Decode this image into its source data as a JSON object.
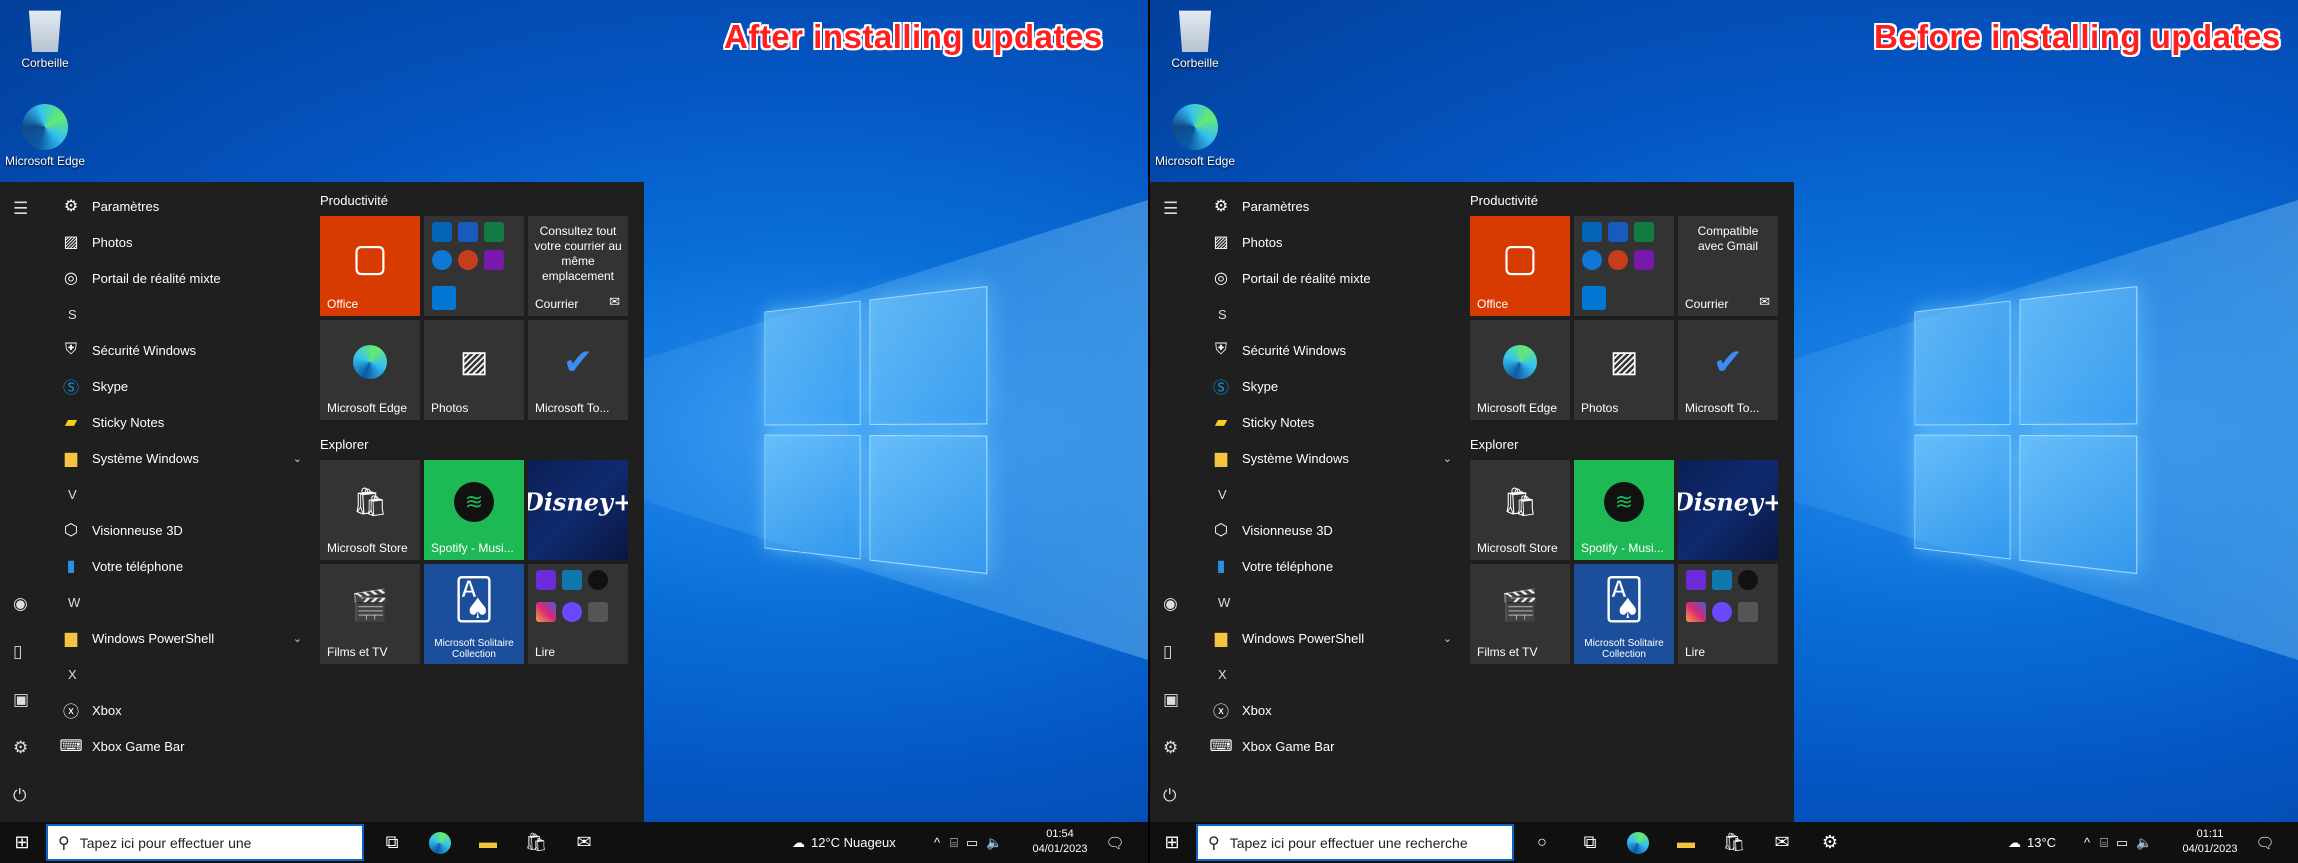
{
  "panels": [
    {
      "id": "left",
      "caption": "After installing updates",
      "desktop": {
        "recycle": "Corbeille",
        "edge": "Microsoft Edge"
      },
      "applist": [
        {
          "type": "app",
          "label": "Paramètres",
          "icon": "gear-icon"
        },
        {
          "type": "app",
          "label": "Photos",
          "icon": "photos-icon"
        },
        {
          "type": "app",
          "label": "Portail de réalité mixte",
          "icon": "mixed-reality-icon"
        },
        {
          "type": "letter",
          "label": "S"
        },
        {
          "type": "app",
          "label": "Sécurité Windows",
          "icon": "shield-icon"
        },
        {
          "type": "app",
          "label": "Skype",
          "icon": "skype-icon"
        },
        {
          "type": "app",
          "label": "Sticky Notes",
          "icon": "sticky-notes-icon"
        },
        {
          "type": "folder",
          "label": "Système Windows",
          "icon": "folder-icon"
        },
        {
          "type": "letter",
          "label": "V"
        },
        {
          "type": "app",
          "label": "Visionneuse 3D",
          "icon": "cube-icon"
        },
        {
          "type": "app",
          "label": "Votre téléphone",
          "icon": "phone-icon"
        },
        {
          "type": "letter",
          "label": "W"
        },
        {
          "type": "folder",
          "label": "Windows PowerShell",
          "icon": "folder-icon"
        },
        {
          "type": "letter",
          "label": "X"
        },
        {
          "type": "app",
          "label": "Xbox",
          "icon": "xbox-icon"
        },
        {
          "type": "app",
          "label": "Xbox Game Bar",
          "icon": "game-bar-icon"
        }
      ],
      "groups": {
        "g1": "Productivité",
        "g2": "Explorer"
      },
      "tiles": {
        "office": "Office",
        "mail_text": "Consultez tout votre courrier au même emplacement",
        "mail": "Courrier",
        "edge": "Microsoft Edge",
        "photos": "Photos",
        "todo": "Microsoft To...",
        "store": "Microsoft Store",
        "spotify": "Spotify - Musi...",
        "disney": "Disney+",
        "films": "Films et TV",
        "solitaire": "Microsoft Solitaire Collection",
        "lire": "Lire"
      },
      "taskbar": {
        "search_placeholder": "Tapez ici pour effectuer une",
        "weather": "12°C  Nuageux",
        "time": "01:54",
        "date": "04/01/2023"
      }
    },
    {
      "id": "right",
      "caption": "Before installing updates",
      "desktop": {
        "recycle": "Corbeille",
        "edge": "Microsoft Edge"
      },
      "applist": [
        {
          "type": "app",
          "label": "Paramètres",
          "icon": "gear-icon"
        },
        {
          "type": "app",
          "label": "Photos",
          "icon": "photos-icon"
        },
        {
          "type": "app",
          "label": "Portail de réalité mixte",
          "icon": "mixed-reality-icon"
        },
        {
          "type": "letter",
          "label": "S"
        },
        {
          "type": "app",
          "label": "Sécurité Windows",
          "icon": "shield-icon"
        },
        {
          "type": "app",
          "label": "Skype",
          "icon": "skype-icon"
        },
        {
          "type": "app",
          "label": "Sticky Notes",
          "icon": "sticky-notes-icon"
        },
        {
          "type": "folder",
          "label": "Système Windows",
          "icon": "folder-icon"
        },
        {
          "type": "letter",
          "label": "V"
        },
        {
          "type": "app",
          "label": "Visionneuse 3D",
          "icon": "cube-icon"
        },
        {
          "type": "app",
          "label": "Votre téléphone",
          "icon": "phone-icon"
        },
        {
          "type": "letter",
          "label": "W"
        },
        {
          "type": "folder",
          "label": "Windows PowerShell",
          "icon": "folder-icon"
        },
        {
          "type": "letter",
          "label": "X"
        },
        {
          "type": "app",
          "label": "Xbox",
          "icon": "xbox-icon"
        },
        {
          "type": "app",
          "label": "Xbox Game Bar",
          "icon": "game-bar-icon"
        }
      ],
      "groups": {
        "g1": "Productivité",
        "g2": "Explorer"
      },
      "tiles": {
        "office": "Office",
        "mail_text": "Compatible avec Gmail",
        "mail": "Courrier",
        "edge": "Microsoft Edge",
        "photos": "Photos",
        "todo": "Microsoft To...",
        "store": "Microsoft Store",
        "spotify": "Spotify - Musi...",
        "disney": "Disney+",
        "films": "Films et TV",
        "solitaire": "Microsoft Solitaire Collection",
        "lire": "Lire"
      },
      "taskbar": {
        "search_placeholder": "Tapez ici pour effectuer une recherche",
        "weather": "13°C",
        "time": "01:11",
        "date": "04/01/2023"
      }
    }
  ],
  "colors": {
    "office": "#d83b01",
    "spotify": "#1db954",
    "accent": "#0a64c8",
    "caption": "#ff1f1f"
  }
}
